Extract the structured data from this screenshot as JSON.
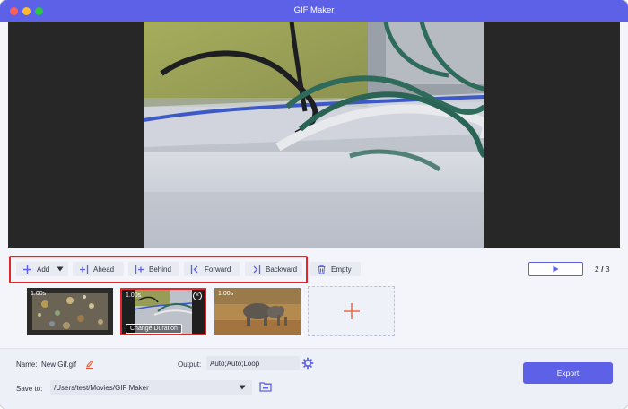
{
  "window": {
    "title": "GIF Maker"
  },
  "toolbar": {
    "add_label": "Add",
    "ahead_label": "Ahead",
    "behind_label": "Behind",
    "forward_label": "Forward",
    "backward_label": "Backward",
    "empty_label": "Empty"
  },
  "pager": {
    "current": "2",
    "separator": "/",
    "total": "3"
  },
  "thumbnails": [
    {
      "duration": "1.00s"
    },
    {
      "duration": "1.00s",
      "change_label": "Change Duration"
    },
    {
      "duration": "1.00s"
    }
  ],
  "settings": {
    "name_label": "Name:",
    "name_value": "New Gif.gif",
    "output_label": "Output:",
    "output_value": "Auto;Auto;Loop",
    "save_label": "Save to:",
    "save_value": "/Users/test/Movies/GIF Maker"
  },
  "export_label": "Export",
  "colors": {
    "accent": "#5d61e7",
    "highlight": "#e3262c",
    "add_plus": "#f06a45"
  }
}
